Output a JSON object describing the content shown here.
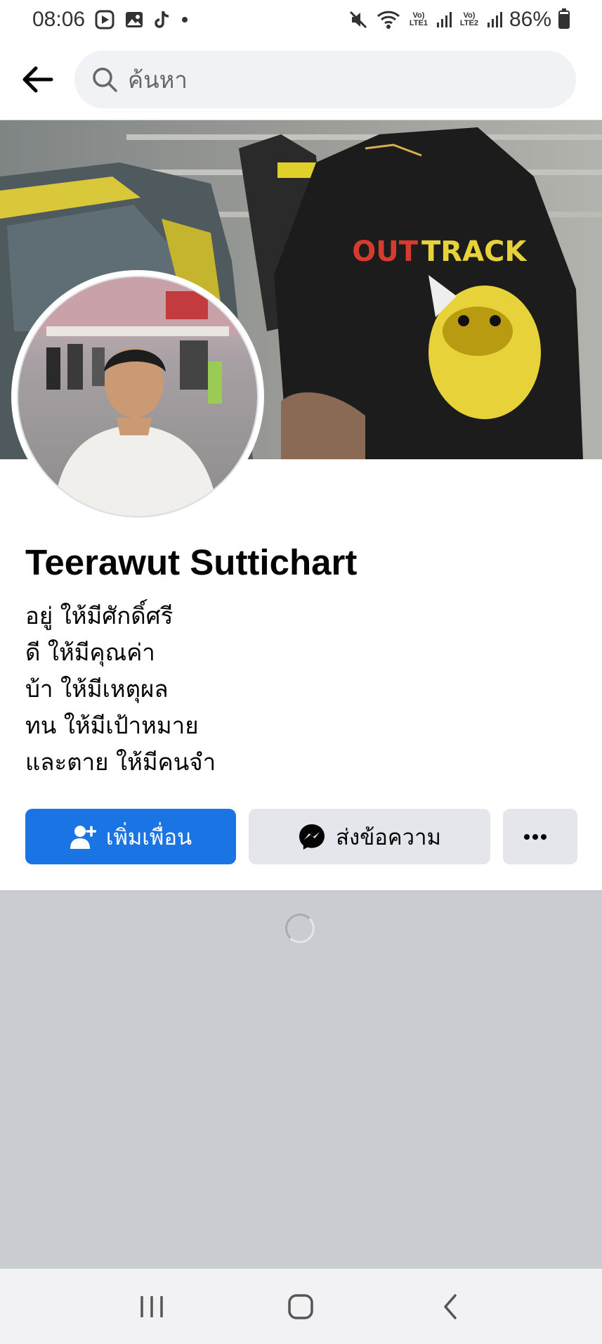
{
  "status_bar": {
    "time": "08:06",
    "battery": "86%",
    "lte1": "Vo) LTE1",
    "lte2": "Vo) LTE2",
    "icons": [
      "play-store-icon",
      "gallery-icon",
      "tiktok-icon",
      "dot-icon",
      "mute-icon",
      "wifi-icon",
      "signal-icon",
      "battery-icon"
    ]
  },
  "search": {
    "placeholder": "ค้นหา"
  },
  "profile": {
    "name": "Teerawut Suttichart",
    "bio": [
      "อยู่ ให้มีศักดิ์ศรี",
      "ดี ให้มีคุณค่า",
      "บ้า ให้มีเหตุผล",
      "ทน ให้มีเป้าหมาย",
      "และตาย ให้มีคนจำ"
    ]
  },
  "actions": {
    "add_friend": "เพิ่มเพื่อน",
    "message": "ส่งข้อความ",
    "more": "•••"
  },
  "colors": {
    "primary": "#1b74e4",
    "secondary_bg": "#e4e6eb",
    "loading_bg": "#c9ccd1"
  }
}
